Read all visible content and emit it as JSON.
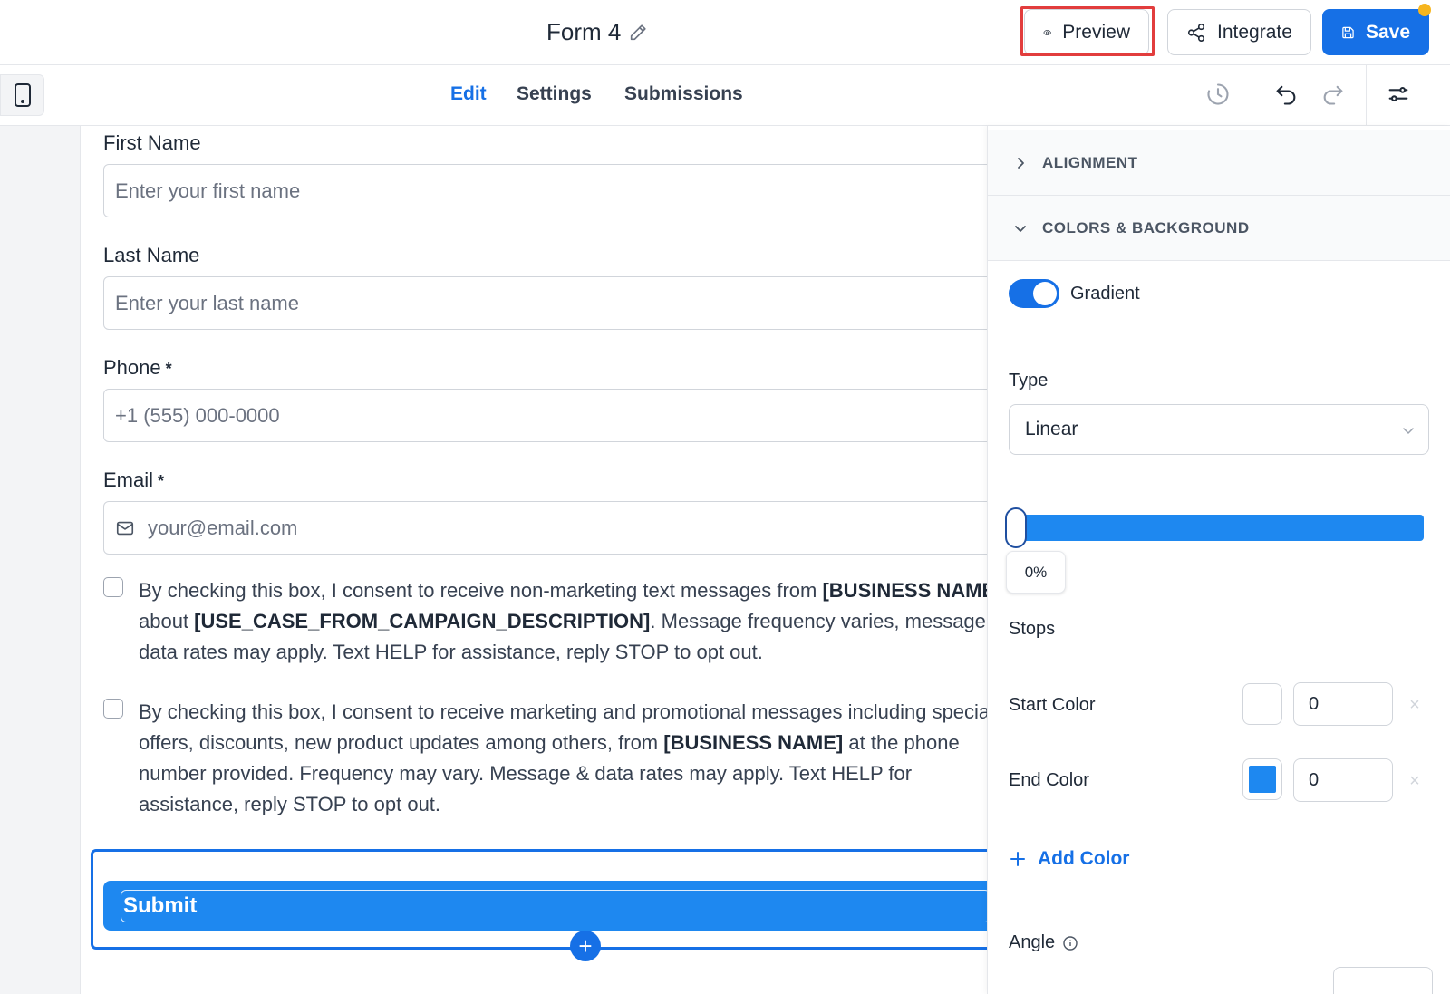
{
  "header": {
    "form_title": "Form 4",
    "preview_label": "Preview",
    "integrate_label": "Integrate",
    "save_label": "Save"
  },
  "toolbar": {
    "tabs": [
      {
        "label": "Edit",
        "active": true
      },
      {
        "label": "Settings",
        "active": false
      },
      {
        "label": "Submissions",
        "active": false
      }
    ]
  },
  "form": {
    "fields": [
      {
        "label": "First Name",
        "placeholder": "Enter your first name",
        "required": false
      },
      {
        "label": "Last Name",
        "placeholder": "Enter your last name",
        "required": false
      },
      {
        "label": "Phone",
        "placeholder": "+1 (555) 000-0000",
        "required": true
      },
      {
        "label": "Email",
        "placeholder": "your@email.com",
        "required": true
      }
    ],
    "required_mark": "*",
    "consents": [
      {
        "t1": "By checking this box, I consent to receive non-marketing text messages from ",
        "b1": "[BUSINESS NAME]",
        "t2": " about ",
        "b2": "[USE_CASE_FROM_CAMPAIGN_DESCRIPTION]",
        "t3": ". Message frequency varies, message & data rates may apply. Text HELP for assistance, reply STOP to opt out."
      },
      {
        "t1": "By checking this box, I consent to receive marketing and promotional messages including special offers, discounts, new product updates among others, from ",
        "b1": "[BUSINESS NAME]",
        "t2": " at the phone number provided. Frequency may vary. Message & data rates may apply. Text HELP for assistance, reply STOP to opt out."
      }
    ],
    "submit_label": "Submit",
    "add_symbol": "+"
  },
  "panel": {
    "alignment_label": "ALIGNMENT",
    "colors_label": "COLORS & BACKGROUND",
    "gradient_label": "Gradient",
    "gradient_on": true,
    "type_label": "Type",
    "type_value": "Linear",
    "stop_position": "0%",
    "stops_label": "Stops",
    "start_color_label": "Start Color",
    "start_color_value": "0",
    "start_color_hex": "#ffffff",
    "end_color_label": "End Color",
    "end_color_value": "0",
    "end_color_hex": "#1e88f0",
    "add_color_label": "Add Color",
    "angle_label": "Angle"
  },
  "colors": {
    "accent": "#1670e6",
    "highlight": "#e23d3d"
  }
}
